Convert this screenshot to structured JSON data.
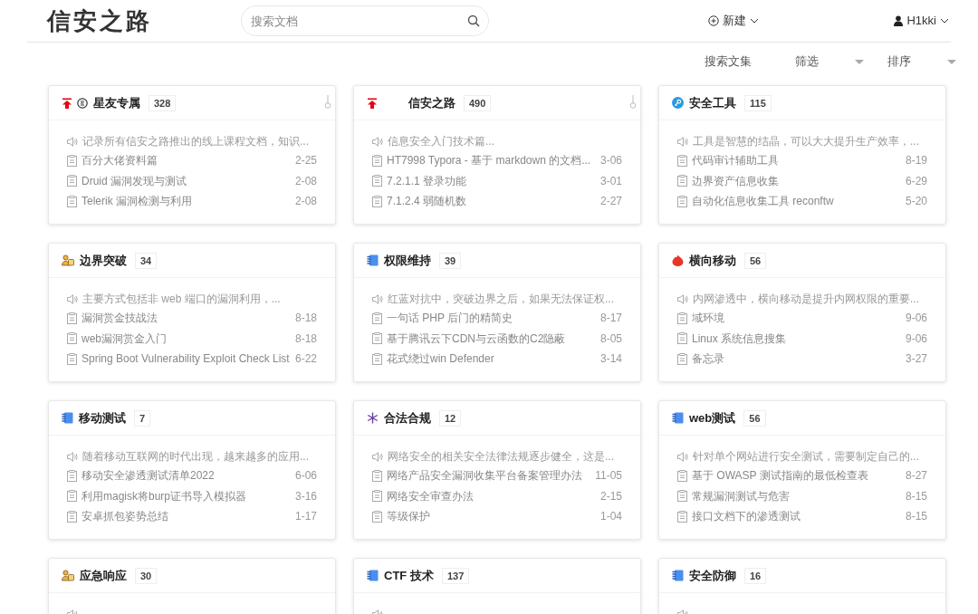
{
  "header": {
    "logo": "信安之路",
    "search": {
      "placeholder": "搜索文档"
    },
    "new_button": "新建",
    "user": "H1kki"
  },
  "toolbar": {
    "search_books": "搜索文集",
    "filter": "筛选",
    "sort": "排序"
  },
  "cards": [
    {
      "title": "星友专属",
      "count": "328",
      "pinned": true,
      "kind": "circle-e",
      "description": "记录所有信安之路推出的线上课程文档，知识...",
      "docs": [
        {
          "title": "百分大佬资料篇",
          "date": "2-25"
        },
        {
          "title": "Druid 漏洞发现与测试",
          "date": "2-08"
        },
        {
          "title": "Telerik 漏洞检测与利用",
          "date": "2-08"
        }
      ]
    },
    {
      "title": "信安之路",
      "count": "490",
      "pinned": true,
      "kind": "blank",
      "description": "信息安全入门技术篇...",
      "docs": [
        {
          "title": "HT7998 Typora - 基于 markdown 的文档...",
          "date": "3-06"
        },
        {
          "title": "7.2.1.1 登录功能",
          "date": "3-01"
        },
        {
          "title": "7.1.2.4 弱随机数",
          "date": "2-27"
        }
      ]
    },
    {
      "title": "安全工具",
      "count": "115",
      "pinned": false,
      "kind": "key",
      "description": "工具是智慧的结晶，可以大大提升生产效率，...",
      "docs": [
        {
          "title": "代码审计辅助工具",
          "date": "8-19"
        },
        {
          "title": "边界资产信息收集",
          "date": "6-29"
        },
        {
          "title": "自动化信息收集工具 reconftw",
          "date": "5-20"
        }
      ]
    },
    {
      "title": "边界突破",
      "count": "34",
      "pinned": false,
      "kind": "users",
      "description": "主要方式包括非 web 端口的漏洞利用，...",
      "docs": [
        {
          "title": "漏洞赏金技战法",
          "date": "8-18"
        },
        {
          "title": "web漏洞赏金入门",
          "date": "8-18"
        },
        {
          "title": "Spring Boot Vulnerability Exploit Check List",
          "date": "6-22"
        }
      ]
    },
    {
      "title": "权限维持",
      "count": "39",
      "pinned": false,
      "kind": "notebook",
      "description": "红蓝对抗中，突破边界之后，如果无法保证权...",
      "docs": [
        {
          "title": "一句话 PHP 后门的精简史",
          "date": "8-17"
        },
        {
          "title": "基于腾讯云下CDN与云函数的C2隐蔽",
          "date": "8-05"
        },
        {
          "title": "花式绕过win Defender",
          "date": "3-14"
        }
      ]
    },
    {
      "title": "横向移动",
      "count": "56",
      "pinned": false,
      "kind": "hot",
      "description": "内网渗透中，横向移动是提升内网权限的重要...",
      "docs": [
        {
          "title": "域环境",
          "date": "9-06"
        },
        {
          "title": "Linux 系统信息搜集",
          "date": "9-06"
        },
        {
          "title": "备忘录",
          "date": "3-27"
        }
      ]
    },
    {
      "title": "移动测试",
      "count": "7",
      "pinned": false,
      "kind": "notebook",
      "description": "随着移动互联网的时代出现，越来越多的应用...",
      "docs": [
        {
          "title": "移动安全渗透测试清单2022",
          "date": "6-06"
        },
        {
          "title": "利用magisk将burp证书导入模拟器",
          "date": "3-16"
        },
        {
          "title": "安卓抓包姿势总结",
          "date": "1-17"
        }
      ]
    },
    {
      "title": "合法合规",
      "count": "12",
      "pinned": false,
      "kind": "snowflake",
      "description": "网络安全的相关安全法律法规逐步健全，这是...",
      "docs": [
        {
          "title": "网络产品安全漏洞收集平台备案管理办法",
          "date": "11-05"
        },
        {
          "title": "网络安全审查办法",
          "date": "2-15"
        },
        {
          "title": "等级保护",
          "date": "1-04"
        }
      ]
    },
    {
      "title": "web测试",
      "count": "56",
      "pinned": false,
      "kind": "notebook",
      "description": "针对单个网站进行安全测试，需要制定自己的...",
      "docs": [
        {
          "title": "基于 OWASP 测试指南的最低检查表",
          "date": "8-27"
        },
        {
          "title": "常规漏洞测试与危害",
          "date": "8-15"
        },
        {
          "title": "接口文档下的渗透测试",
          "date": "8-15"
        }
      ]
    },
    {
      "title": "应急响应",
      "count": "30",
      "pinned": false,
      "kind": "users"
    },
    {
      "title": "CTF 技术",
      "count": "137",
      "pinned": false,
      "kind": "notebook"
    },
    {
      "title": "安全防御",
      "count": "16",
      "pinned": false,
      "kind": "notebook"
    }
  ]
}
